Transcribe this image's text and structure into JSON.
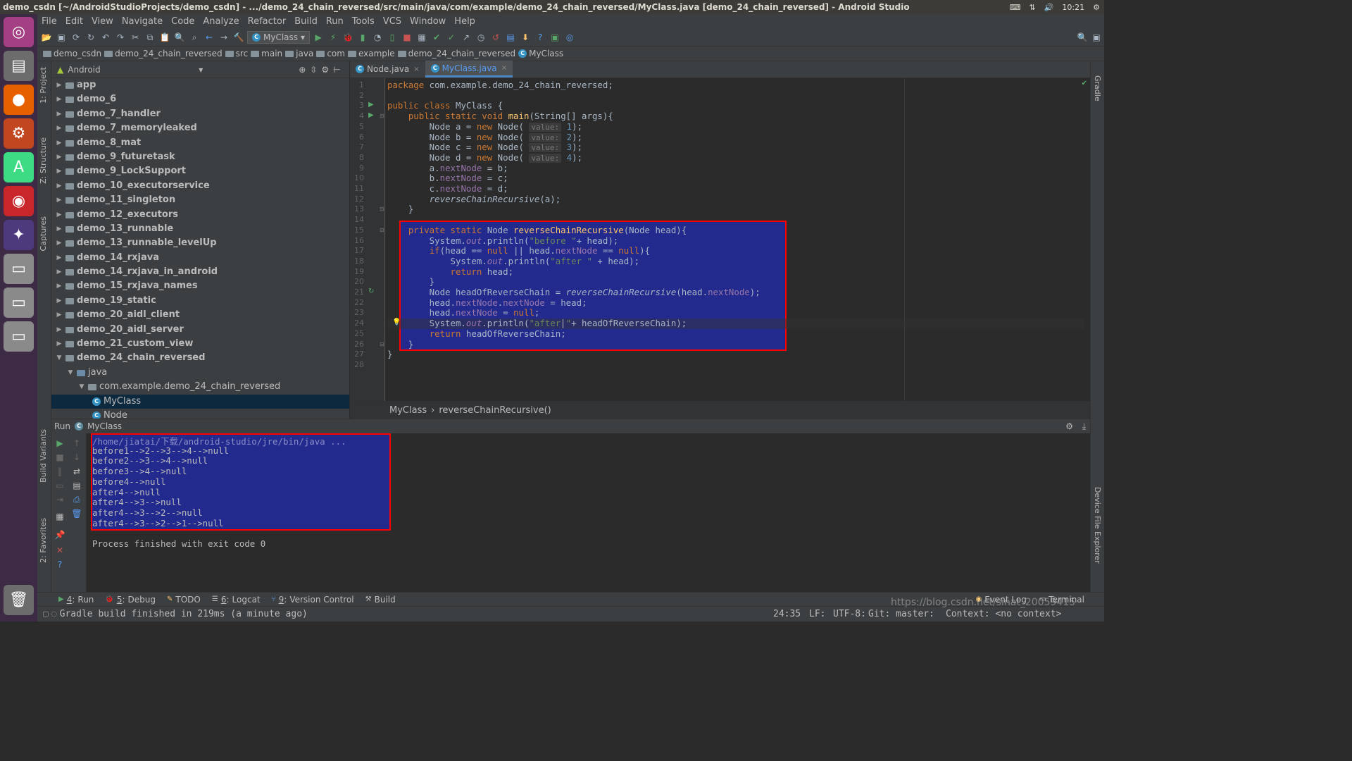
{
  "window": {
    "title": "demo_csdn [~/AndroidStudioProjects/demo_csdn] - .../demo_24_chain_reversed/src/main/java/com/example/demo_24_chain_reversed/MyClass.java [demo_24_chain_reversed] - Android Studio",
    "clock": "10:21"
  },
  "menu": [
    "File",
    "Edit",
    "View",
    "Navigate",
    "Code",
    "Analyze",
    "Refactor",
    "Build",
    "Run",
    "Tools",
    "VCS",
    "Window",
    "Help"
  ],
  "toolbar": {
    "run_config": "MyClass"
  },
  "breadcrumb": [
    "demo_csdn",
    "demo_24_chain_reversed",
    "src",
    "main",
    "java",
    "com",
    "example",
    "demo_24_chain_reversed",
    "MyClass"
  ],
  "left_strip": {
    "project": "1: Project",
    "structure": "Z: Structure",
    "captures": "Captures",
    "build_variants": "Build Variants",
    "favorites": "2: Favorites"
  },
  "right_strip": {
    "gradle": "Gradle",
    "device_explorer": "Device File Explorer"
  },
  "project": {
    "view": "Android",
    "tree": [
      {
        "label": "app",
        "depth": 0,
        "expanded": false
      },
      {
        "label": "demo_6",
        "depth": 0,
        "expanded": false
      },
      {
        "label": "demo_7_handler",
        "depth": 0,
        "expanded": false
      },
      {
        "label": "demo_7_memoryleaked",
        "depth": 0,
        "expanded": false
      },
      {
        "label": "demo_8_mat",
        "depth": 0,
        "expanded": false
      },
      {
        "label": "demo_9_futuretask",
        "depth": 0,
        "expanded": false
      },
      {
        "label": "demo_9_LockSupport",
        "depth": 0,
        "expanded": false
      },
      {
        "label": "demo_10_executorservice",
        "depth": 0,
        "expanded": false
      },
      {
        "label": "demo_11_singleton",
        "depth": 0,
        "expanded": false
      },
      {
        "label": "demo_12_executors",
        "depth": 0,
        "expanded": false
      },
      {
        "label": "demo_13_runnable",
        "depth": 0,
        "expanded": false
      },
      {
        "label": "demo_13_runnable_levelUp",
        "depth": 0,
        "expanded": false
      },
      {
        "label": "demo_14_rxjava",
        "depth": 0,
        "expanded": false
      },
      {
        "label": "demo_14_rxjava_in_android",
        "depth": 0,
        "expanded": false
      },
      {
        "label": "demo_15_rxjava_names",
        "depth": 0,
        "expanded": false
      },
      {
        "label": "demo_19_static",
        "depth": 0,
        "expanded": false
      },
      {
        "label": "demo_20_aidl_client",
        "depth": 0,
        "expanded": false
      },
      {
        "label": "demo_20_aidl_server",
        "depth": 0,
        "expanded": false
      },
      {
        "label": "demo_21_custom_view",
        "depth": 0,
        "expanded": false
      },
      {
        "label": "demo_24_chain_reversed",
        "depth": 0,
        "expanded": true
      },
      {
        "label": "java",
        "depth": 1,
        "expanded": true
      },
      {
        "label": "com.example.demo_24_chain_reversed",
        "depth": 2,
        "expanded": true
      },
      {
        "label": "MyClass",
        "depth": 3,
        "selected": true,
        "class": true
      },
      {
        "label": "Node",
        "depth": 3,
        "class": true
      }
    ]
  },
  "tabs": [
    {
      "label": "Node.java",
      "active": false
    },
    {
      "label": "MyClass.java",
      "active": true
    }
  ],
  "code_lines": [
    "<span class=\"kw\">package</span> com.example.demo_24_chain_reversed;",
    "",
    "<span class=\"kw\">public class</span> MyClass {",
    "    <span class=\"kw\">public static void</span> <span class=\"fn\">main</span>(String[] args){",
    "        Node a = <span class=\"kw\">new</span> Node( <span class=\"hint\">value:</span> <span class=\"num\">1</span>);",
    "        Node b = <span class=\"kw\">new</span> Node( <span class=\"hint\">value:</span> <span class=\"num\">2</span>);",
    "        Node c = <span class=\"kw\">new</span> Node( <span class=\"hint\">value:</span> <span class=\"num\">3</span>);",
    "        Node d = <span class=\"kw\">new</span> Node( <span class=\"hint\">value:</span> <span class=\"num\">4</span>);",
    "        a.<span class=\"fld\">nextNode</span> = b;",
    "        b.<span class=\"fld\">nextNode</span> = c;",
    "        c.<span class=\"fld\">nextNode</span> = d;",
    "        <span class=\"it\">reverseChainRecursive</span>(a);",
    "    }",
    "",
    "    <span class=\"kw\">private static</span> Node <span class=\"fn\">reverseChainRecursive</span>(Node head){",
    "        System.<span class=\"fld it\">out</span>.println(<span class=\"st\">\"before \"</span>+ head);",
    "        <span class=\"kw\">if</span>(head == <span class=\"kw\">null</span> || head.<span class=\"fld\">nextNode</span> == <span class=\"kw\">null</span>){",
    "            System.<span class=\"fld it\">out</span>.println(<span class=\"st\">\"after \"</span> + head);",
    "            <span class=\"kw\">return</span> head;",
    "        }",
    "        Node headOfReverseChain = <span class=\"it\">reverseChainRecursive</span>(head.<span class=\"fld\">nextNode</span>);",
    "        head.<span class=\"fld\">nextNode</span>.<span class=\"fld\">nextNode</span> = head;",
    "        head.<span class=\"fld\">nextNode</span> = <span class=\"kw\">null</span>;",
    "        System.<span class=\"fld it\">out</span>.println(<span class=\"st\">\"after \"</span>+ headOfReverseChain);",
    "        <span class=\"kw\">return</span> headOfReverseChain;",
    "    }",
    "}",
    ""
  ],
  "editor_breadcrumb": [
    "MyClass",
    "reverseChainRecursive()"
  ],
  "run": {
    "label": "Run",
    "config": "MyClass",
    "console": [
      "/home/jiatai/下载/android-studio/jre/bin/java ...",
      "before1-->2-->3-->4-->null",
      "before2-->3-->4-->null",
      "before3-->4-->null",
      "before4-->null",
      "after4-->null",
      "after4-->3-->null",
      "after4-->3-->2-->null",
      "after4-->3-->2-->1-->null",
      "",
      "Process finished with exit code 0"
    ]
  },
  "bottom_tools": [
    {
      "num": "4",
      "label": "Run"
    },
    {
      "num": "5",
      "label": "Debug"
    },
    {
      "num": "",
      "label": "TODO"
    },
    {
      "num": "6",
      "label": "Logcat"
    },
    {
      "num": "9",
      "label": "Version Control"
    },
    {
      "num": "",
      "label": "Build"
    }
  ],
  "bottom_right_tools": [
    "Event Log",
    "Terminal"
  ],
  "status": {
    "message": "Gradle build finished in 219ms (a minute ago)",
    "position": "24:35",
    "line_sep": "LF:",
    "encoding": "UTF-8:",
    "git": "Git: master:",
    "context": "Context: <no context>",
    "watermark": "https://blog.csdn.net/sinat_20059415"
  }
}
